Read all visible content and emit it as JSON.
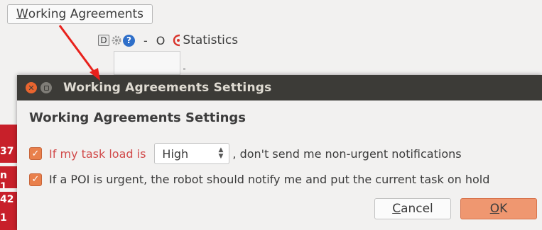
{
  "menu": {
    "label_mnemonic": "W",
    "label_rest": "orking Agreements"
  },
  "toolbar": {
    "d_label": "D",
    "help_label": "?",
    "minus_label": "-",
    "o_label": "O",
    "statistics_label": "Statistics"
  },
  "behind_window": {
    "fragments": [
      "37",
      "n 1",
      "1",
      "42",
      "1"
    ]
  },
  "dialog": {
    "window_title": "Working Agreements Settings",
    "heading": "Working Agreements Settings",
    "row1": {
      "checked": true,
      "label": "If my task load is",
      "select_value": "High",
      "suffix": ", don't send me non-urgent notifications"
    },
    "row2": {
      "checked": true,
      "label": "If a POI is urgent, the robot should notify me and put the current task on hold"
    },
    "cancel_mnemonic": "C",
    "cancel_rest": "ancel",
    "ok_mnemonic": "O",
    "ok_rest": "K"
  },
  "colors": {
    "accent": "#e9804c",
    "titlebar": "#3c3b37",
    "annotation_arrow": "#e8211c",
    "behind_window": "#c8202a"
  },
  "icons": [
    "gear-icon",
    "help-icon",
    "statistics-icon",
    "close-icon",
    "minimize-icon",
    "checkmark-icon"
  ]
}
